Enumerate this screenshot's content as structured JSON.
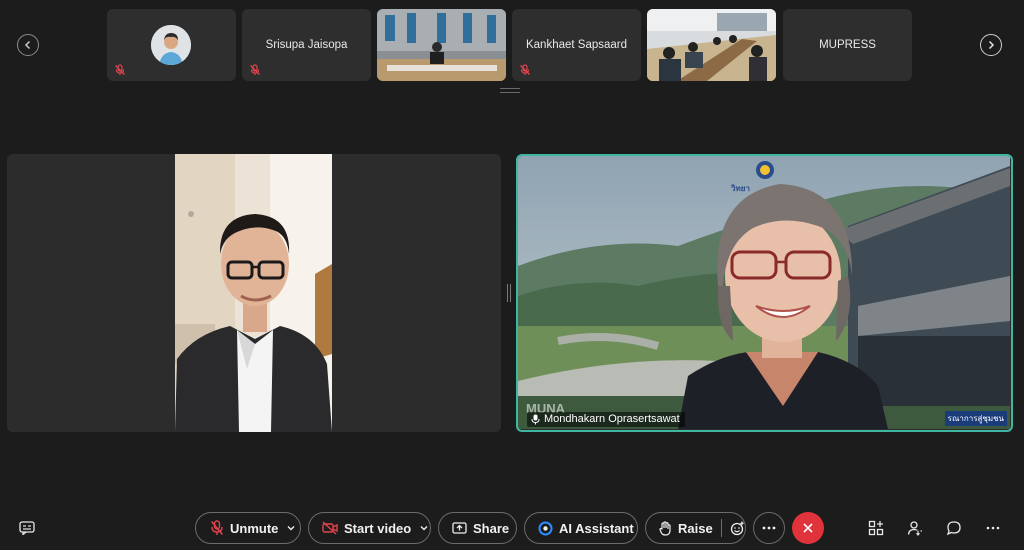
{
  "participants_strip": [
    {
      "name": "",
      "muted": true,
      "kind": "avatar"
    },
    {
      "name": "Srisupa Jaisopa",
      "muted": true,
      "kind": "name"
    },
    {
      "name": "",
      "muted": false,
      "kind": "video-room"
    },
    {
      "name": "Kankhaet Sapsaard",
      "muted": true,
      "kind": "name"
    },
    {
      "name": "",
      "muted": false,
      "kind": "video-classroom"
    },
    {
      "name": "MUPRESS",
      "muted": false,
      "kind": "name"
    }
  ],
  "stage": {
    "right_tile_name": "Mondhakarn Oprasertsawat",
    "right_tile_watermark": "MUNA",
    "right_tile_corner": "รณาการสู่ชุมชน",
    "right_tile_logo_text": "วิทยา"
  },
  "toolbar": {
    "unmute_label": "Unmute",
    "start_video_label": "Start video",
    "share_label": "Share",
    "ai_assistant_label": "AI Assistant",
    "raise_label": "Raise"
  },
  "colors": {
    "background": "#1c1c1c",
    "active_speaker_border": "#3fb6a0",
    "mute_red": "#e0444e",
    "leave_button": "#e0333c"
  },
  "icons": [
    "chevron-left-icon",
    "chevron-right-icon",
    "mic-muted-icon",
    "video-off-icon",
    "share-icon",
    "ai-assistant-icon",
    "raise-hand-icon",
    "emoji-icon",
    "more-icon",
    "leave-icon",
    "layout-icon",
    "participants-icon",
    "chat-icon",
    "closed-captions-icon"
  ]
}
